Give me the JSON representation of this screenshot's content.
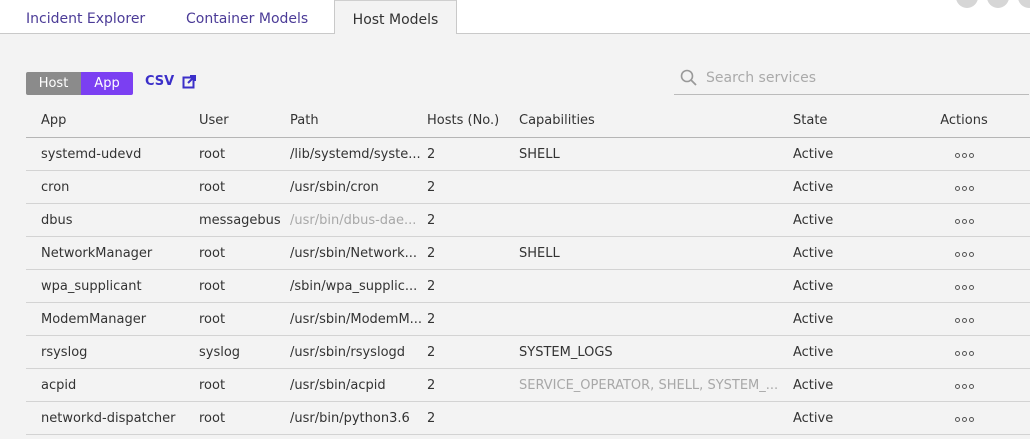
{
  "tabs": [
    {
      "label": "Incident Explorer"
    },
    {
      "label": "Container Models"
    },
    {
      "label": "Host Models"
    }
  ],
  "toolbar": {
    "toggle_host": "Host",
    "toggle_app": "App",
    "csv_label": "CSV",
    "search_placeholder": "Search services"
  },
  "colors": {
    "accent": "#7b3ff2",
    "tab_text": "#4b3b97",
    "link": "#3b2fc9"
  },
  "table": {
    "headers": {
      "app": "App",
      "user": "User",
      "path": "Path",
      "hosts": "Hosts (No.)",
      "capabilities": "Capabilities",
      "state": "State",
      "actions": "Actions"
    },
    "rows": [
      {
        "app": "systemd-udevd",
        "user": "root",
        "path": "/lib/systemd/syste...",
        "hosts": "2",
        "capabilities": "SHELL",
        "state": "Active"
      },
      {
        "app": "cron",
        "user": "root",
        "path": "/usr/sbin/cron",
        "hosts": "2",
        "capabilities": "",
        "state": "Active"
      },
      {
        "app": "dbus",
        "user": "messagebus",
        "path": "/usr/bin/dbus-dae...",
        "hosts": "2",
        "capabilities": "",
        "state": "Active"
      },
      {
        "app": "NetworkManager",
        "user": "root",
        "path": "/usr/sbin/Network...",
        "hosts": "2",
        "capabilities": "SHELL",
        "state": "Active"
      },
      {
        "app": "wpa_supplicant",
        "user": "root",
        "path": "/sbin/wpa_supplic...",
        "hosts": "2",
        "capabilities": "",
        "state": "Active"
      },
      {
        "app": "ModemManager",
        "user": "root",
        "path": "/usr/sbin/ModemM...",
        "hosts": "2",
        "capabilities": "",
        "state": "Active"
      },
      {
        "app": "rsyslog",
        "user": "syslog",
        "path": "/usr/sbin/rsyslogd",
        "hosts": "2",
        "capabilities": "SYSTEM_LOGS",
        "state": "Active"
      },
      {
        "app": "acpid",
        "user": "root",
        "path": "/usr/sbin/acpid",
        "hosts": "2",
        "capabilities": "SERVICE_OPERATOR, SHELL, SYSTEM_...",
        "state": "Active"
      },
      {
        "app": "networkd-dispatcher",
        "user": "root",
        "path": "/usr/bin/python3.6",
        "hosts": "2",
        "capabilities": "",
        "state": "Active"
      }
    ]
  }
}
